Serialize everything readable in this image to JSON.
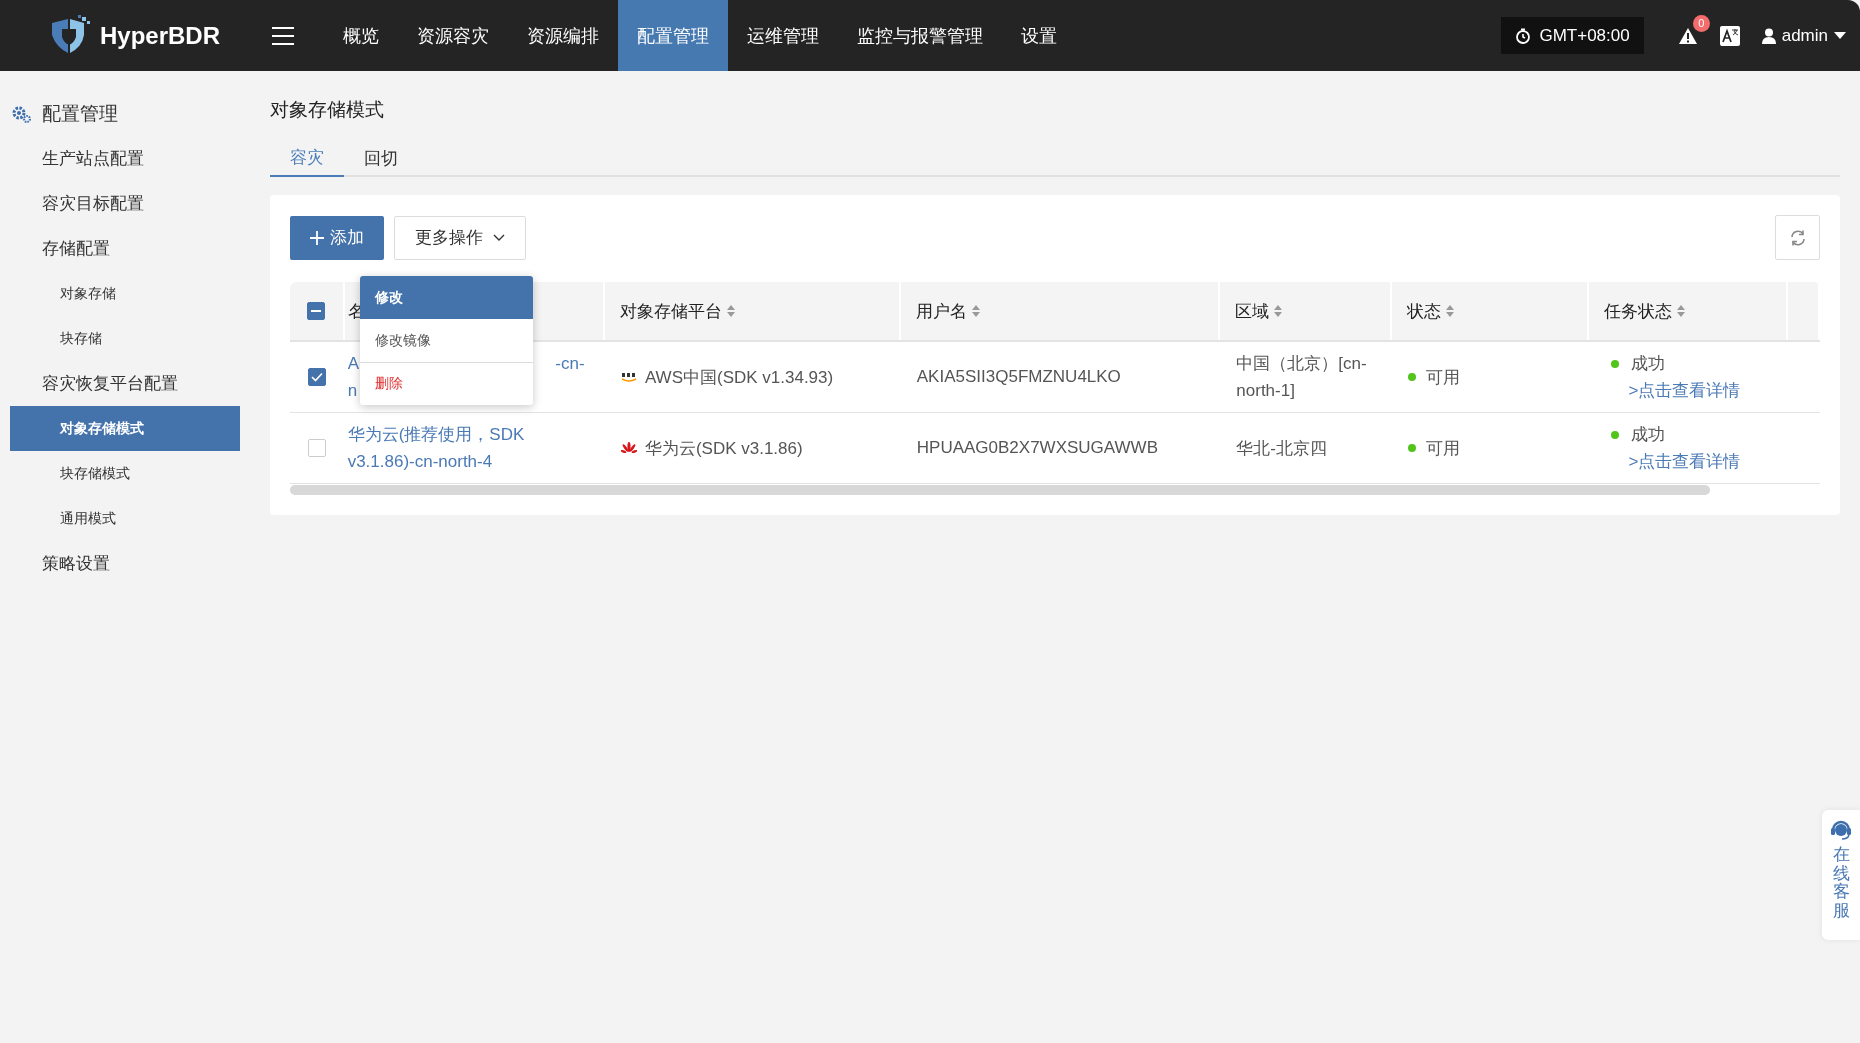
{
  "header": {
    "logo": "HyperBDR",
    "nav": [
      {
        "label": "概览",
        "selected": false
      },
      {
        "label": "资源容灾",
        "selected": false
      },
      {
        "label": "资源编排",
        "selected": false
      },
      {
        "label": "配置管理",
        "selected": true
      },
      {
        "label": "运维管理",
        "selected": false
      },
      {
        "label": "监控与报警管理",
        "selected": false
      },
      {
        "label": "设置",
        "selected": false
      }
    ],
    "timezone": "GMT+08:00",
    "alert_count": "0",
    "user": "admin"
  },
  "sidebar": {
    "title": "配置管理",
    "items": [
      {
        "label": "生产站点配置",
        "selected": false
      },
      {
        "label": "容灾目标配置",
        "selected": false
      },
      {
        "label": "存储配置",
        "selected": false,
        "children": [
          {
            "label": "对象存储",
            "selected": false
          },
          {
            "label": "块存储",
            "selected": false
          }
        ]
      },
      {
        "label": "容灾恢复平台配置",
        "selected": false,
        "children": [
          {
            "label": "对象存储模式",
            "selected": true
          },
          {
            "label": "块存储模式",
            "selected": false
          },
          {
            "label": "通用模式",
            "selected": false
          }
        ]
      },
      {
        "label": "策略设置",
        "selected": false
      }
    ]
  },
  "page": {
    "title": "对象存储模式",
    "tabs": [
      {
        "label": "容灾",
        "selected": true
      },
      {
        "label": "回切",
        "selected": false
      }
    ]
  },
  "toolbar": {
    "add_button": "添加",
    "more_button": "更多操作"
  },
  "more_menu": [
    {
      "label": "修改",
      "kind": "normal",
      "selected": true
    },
    {
      "label": "修改镜像",
      "kind": "normal",
      "selected": false
    },
    {
      "label": "删除",
      "kind": "danger",
      "selected": false
    }
  ],
  "table": {
    "select_all": {
      "indeterminate": true
    },
    "columns": [
      {
        "label": "名"
      },
      {
        "label": "对象存储平台"
      },
      {
        "label": "用户名"
      },
      {
        "label": "区域"
      },
      {
        "label": "状态"
      },
      {
        "label": "任务状态"
      }
    ],
    "rows": [
      {
        "checked": true,
        "name_fragments": [
          "A",
          "-cn-",
          "n"
        ],
        "platform": {
          "kind": "aws",
          "label": "AWS中国(SDK v1.34.93)"
        },
        "username": "AKIA5SII3Q5FMZNU4LKO",
        "region": "中国（北京）[cn-north-1]",
        "status": "可用",
        "task_status": "成功",
        "task_link": ">点击查看详情"
      },
      {
        "checked": false,
        "name": "华为云(推荐使用，SDK v3.1.86)-cn-north-4",
        "platform": {
          "kind": "huawei",
          "label": "华为云(SDK v3.1.86)"
        },
        "username": "HPUAAG0B2X7WXSUGAWWB",
        "region": "华北-北京四",
        "status": "可用",
        "task_status": "成功",
        "task_link": ">点击查看详情"
      }
    ]
  },
  "support_widget": {
    "label": "在线客服"
  }
}
